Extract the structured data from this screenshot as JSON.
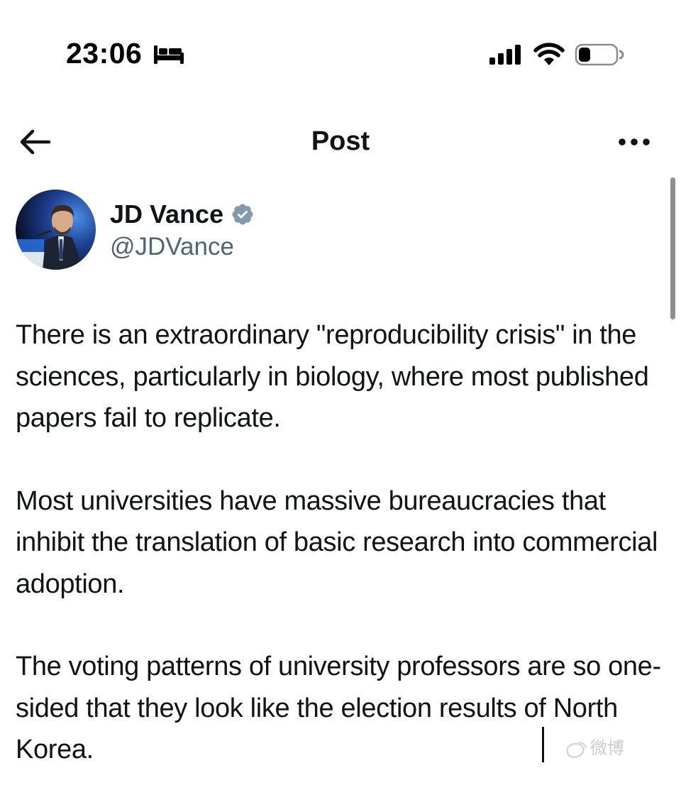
{
  "status_bar": {
    "time": "23:06",
    "icons": [
      "bed-icon",
      "cellular-signal-icon",
      "wifi-icon",
      "battery-icon"
    ]
  },
  "header": {
    "title": "Post",
    "back_icon": "arrow-left-icon",
    "more_icon": "more-horizontal-icon"
  },
  "author": {
    "name": "JD Vance",
    "handle": "@JDVance",
    "verified": true,
    "verified_color": "#829aab"
  },
  "post": {
    "paragraphs": [
      "There is an extraordinary \"reproducibility crisis\" in the sciences, particularly in biology, where most published papers fail to replicate.",
      "Most universities have massive bureaucracies that inhibit the translation of basic research into commercial adoption.",
      "The voting patterns of university professors are so one-sided that they look like the election results of North Korea."
    ]
  },
  "watermark": {
    "text": "微博"
  },
  "colors": {
    "text_primary": "#0f1419",
    "text_secondary": "#536471",
    "background": "#ffffff",
    "scrollbar": "#8e8e8e"
  }
}
